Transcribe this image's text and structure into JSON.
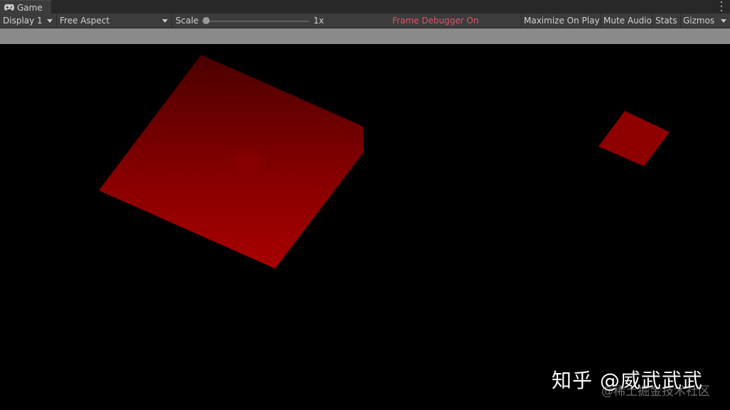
{
  "tab": {
    "title": "Game",
    "icon": "gamepad-icon"
  },
  "toolbar": {
    "display": "Display 1",
    "aspect": "Free Aspect",
    "scale_label": "Scale",
    "scale_value": "1x",
    "frame_debugger": "Frame Debugger On",
    "maximize": "Maximize On Play",
    "mute": "Mute Audio",
    "stats": "Stats",
    "gizmos": "Gizmos"
  },
  "colors": {
    "frame_debugger": "#e0536b",
    "cube_top": "#5a0000",
    "cube_bottom": "#a00000",
    "small_quad": "#8f0000"
  },
  "watermark": {
    "primary": "知乎 @威武武武",
    "secondary": "@稀土掘金技术社区"
  }
}
